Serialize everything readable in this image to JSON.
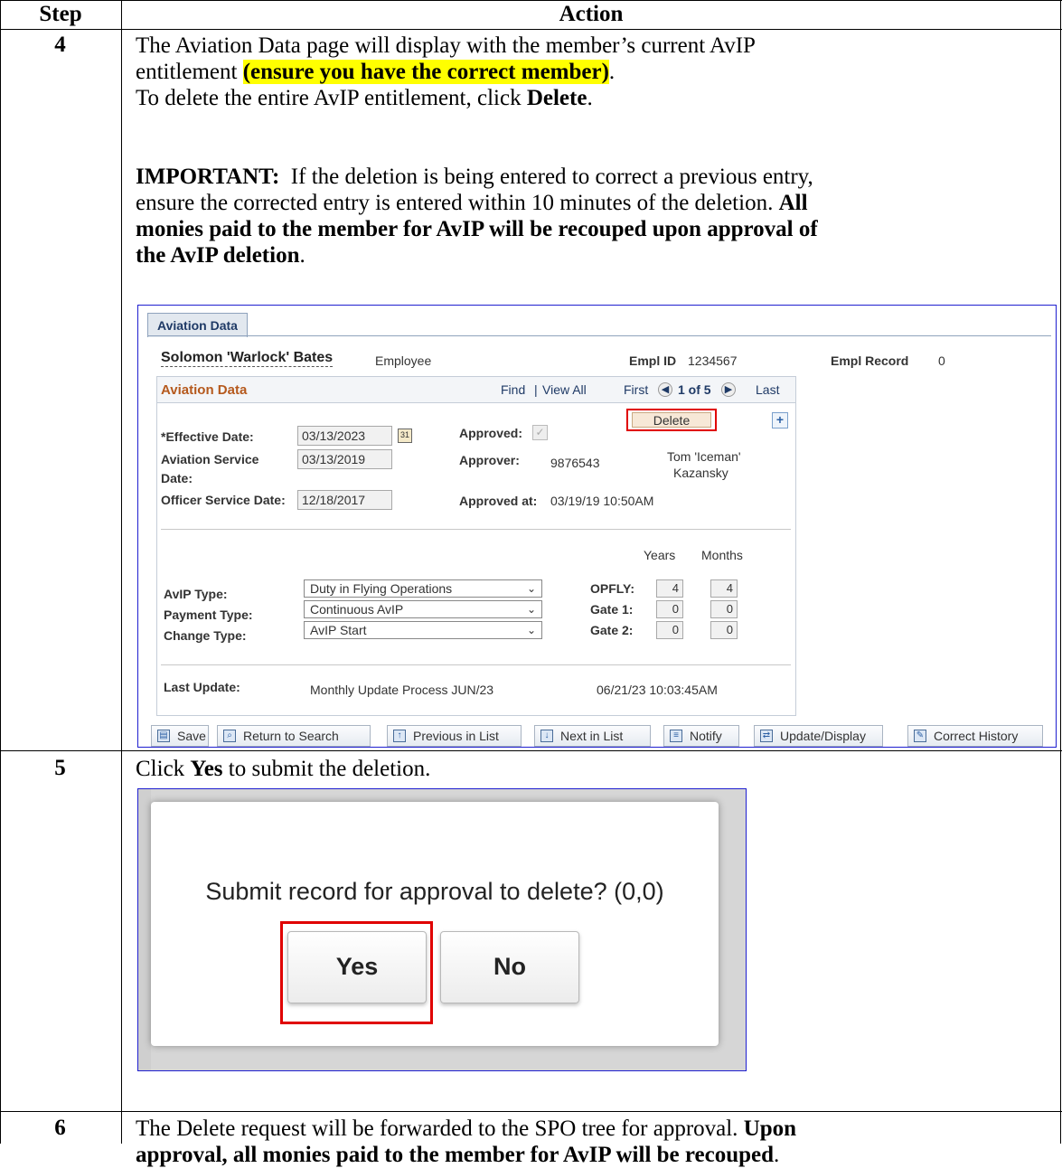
{
  "table": {
    "header_step": "Step",
    "header_action": "Action"
  },
  "step4": {
    "number": "4",
    "line1": "The Aviation Data page will display with the member’s current AvIP",
    "line2_pre": "entitlement ",
    "line2_hl": "(ensure you have the correct member)",
    "line2_post": ".",
    "line3_pre": "To delete the entire AvIP entitlement, click ",
    "line3_bold": "Delete",
    "line3_post": ".",
    "important_label": "IMPORTANT:",
    "important_text": "  If the deletion is being entered to correct a previous entry,",
    "line5_pre": "ensure the corrected entry is entered within 10 minutes of the deletion. ",
    "line5_bold": "All",
    "line6_bold": "monies paid to the member for AvIP will be recouped upon approval of",
    "line7_bold": "the AvIP deletion",
    "line7_post": "."
  },
  "aviation_ui": {
    "tab": "Aviation Data",
    "name": "Solomon 'Warlock' Bates",
    "role": "Employee",
    "empl_id_label": "Empl ID",
    "empl_id": "1234567",
    "empl_record_label": "Empl Record",
    "empl_record": "0",
    "grid_title": "Aviation Data",
    "find": "Find",
    "view_all": "View All",
    "sep": "|",
    "first": "First",
    "counter": "1 of 5",
    "last": "Last",
    "delete": "Delete",
    "plus": "+",
    "effective_date_label": "*Effective Date:",
    "effective_date": "03/13/2023",
    "calendar": "31",
    "aviation_service_label": "Aviation Service",
    "date_label": "Date:",
    "aviation_service_date": "03/13/2019",
    "officer_service_label": "Officer Service Date:",
    "officer_service_date": "12/18/2017",
    "approved_label": "Approved:",
    "approver_label": "Approver:",
    "approver_id": "9876543",
    "approver_name1": "Tom 'Iceman'",
    "approver_name2": "Kazansky",
    "approved_at_label": "Approved at:",
    "approved_at": "03/19/19 10:50AM",
    "years": "Years",
    "months": "Months",
    "avip_type_label": "AvIP Type:",
    "avip_type": "Duty in Flying Operations",
    "payment_type_label": "Payment Type:",
    "payment_type": "Continuous AvIP",
    "change_type_label": "Change Type:",
    "change_type": "AvIP Start",
    "opfly_label": "OPFLY:",
    "opfly_years": "4",
    "opfly_months": "4",
    "gate1_label": "Gate 1:",
    "gate1_years": "0",
    "gate1_months": "0",
    "gate2_label": "Gate 2:",
    "gate2_years": "0",
    "gate2_months": "0",
    "last_update_label": "Last Update:",
    "last_update_process": "Monthly Update Process JUN/23",
    "last_update_time": "06/21/23 10:03:45AM",
    "toolbar": {
      "save": "Save",
      "return": "Return to Search",
      "previous": "Previous in List",
      "next": "Next in List",
      "notify": "Notify",
      "update": "Update/Display",
      "correct": "Correct History"
    }
  },
  "step5": {
    "number": "5",
    "pre": "Click ",
    "bold": "Yes",
    "post": " to submit the deletion.",
    "dialog_message": "Submit record for approval to delete? (0,0)",
    "yes": "Yes",
    "no": "No"
  },
  "step6": {
    "number": "6",
    "line1_pre": "The Delete request will be forwarded to the SPO tree for approval. ",
    "line1_bold": "Upon",
    "line2_bold": "approval, all monies paid to the member for AvIP will be recouped",
    "line2_post": "."
  }
}
